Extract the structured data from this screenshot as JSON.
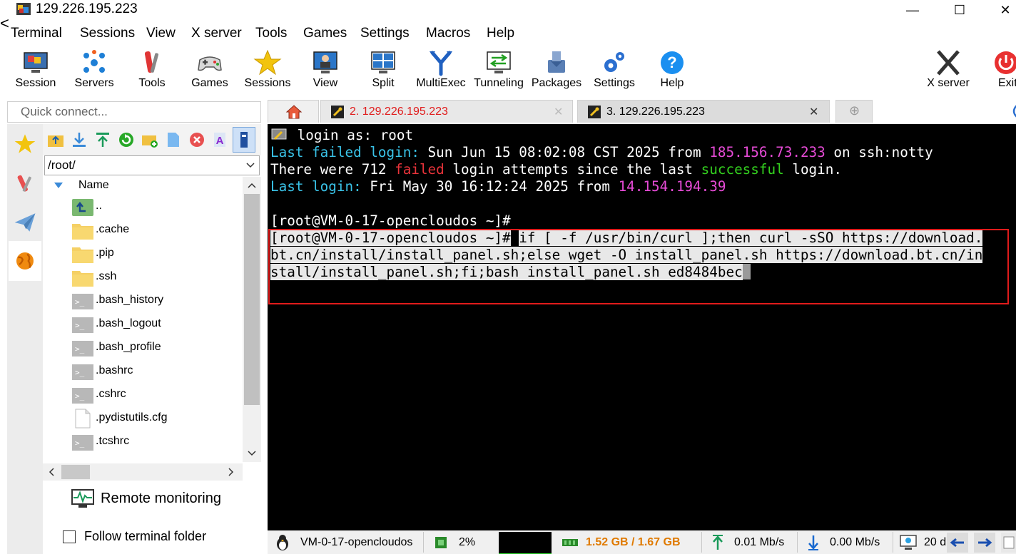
{
  "window": {
    "title": "129.226.195.223",
    "minimize": "—",
    "maximize": "☐",
    "close": "✕",
    "back": "<"
  },
  "menu": [
    "Terminal",
    "Sessions",
    "View",
    "X server",
    "Tools",
    "Games",
    "Settings",
    "Macros",
    "Help"
  ],
  "toolbar": {
    "session": "Session",
    "servers": "Servers",
    "tools": "Tools",
    "games": "Games",
    "sessions": "Sessions",
    "view": "View",
    "split": "Split",
    "multiexec": "MultiExec",
    "tunneling": "Tunneling",
    "packages": "Packages",
    "settings": "Settings",
    "help": "Help",
    "xserver": "X server",
    "exit": "Exit"
  },
  "quick_connect": {
    "placeholder": "Quick connect..."
  },
  "tabs": [
    {
      "label": "2. 129.226.195.223",
      "color": "#e01b1b"
    },
    {
      "label": "3. 129.226.195.223",
      "color": "#000000"
    }
  ],
  "sftp": {
    "path": "/root/",
    "column_header": "Name",
    "files": [
      {
        "name": "..",
        "type": "parent"
      },
      {
        "name": ".cache",
        "type": "folder"
      },
      {
        "name": ".pip",
        "type": "folder"
      },
      {
        "name": ".ssh",
        "type": "folder"
      },
      {
        "name": ".bash_history",
        "type": "script"
      },
      {
        "name": ".bash_logout",
        "type": "script"
      },
      {
        "name": ".bash_profile",
        "type": "script"
      },
      {
        "name": ".bashrc",
        "type": "script"
      },
      {
        "name": ".cshrc",
        "type": "script"
      },
      {
        "name": ".pydistutils.cfg",
        "type": "file"
      },
      {
        "name": ".tcshrc",
        "type": "script"
      }
    ],
    "remote_monitoring": "Remote monitoring",
    "follow_terminal": "Follow terminal folder"
  },
  "terminal": {
    "line1": {
      "prompt": "login as: ",
      "value": "root"
    },
    "line2": {
      "a": "Last failed login:",
      "b": " Sun Jun 15 08:02:08 CST 2025 from ",
      "ip": "185.156.73.233",
      "c": " on ssh:notty"
    },
    "line3": {
      "a": "There were 712 ",
      "failed": "failed",
      "b": " login attempts since the last ",
      "success": "successful",
      "c": " login."
    },
    "line4": {
      "a": "Last login:",
      "b": " Fri May 30 16:12:24 2025 from ",
      "ip": "14.154.194.39"
    },
    "line6": "[root@VM-0-17-opencloudos ~]#",
    "line7": {
      "prompt": "[root@VM-0-17-opencloudos ~]#",
      "cmd": "if [ -f /usr/bin/curl ];then curl -sSO https://download."
    },
    "line8": "bt.cn/install/install_panel.sh;else wget -O install_panel.sh https://download.bt.cn/in",
    "line9": "stall/install_panel.sh;fi;bash install_panel.sh ed8484bec"
  },
  "status": {
    "host": "VM-0-17-opencloudos",
    "cpu": "2%",
    "memory": "1.52 GB / 1.67 GB",
    "upload": "0.01 Mb/s",
    "download": "0.00 Mb/s",
    "users": "20 d"
  },
  "colors": {
    "highlight_box": "#e01b1b",
    "memory_text": "#e07a00",
    "terminal_bg": "#000000"
  }
}
